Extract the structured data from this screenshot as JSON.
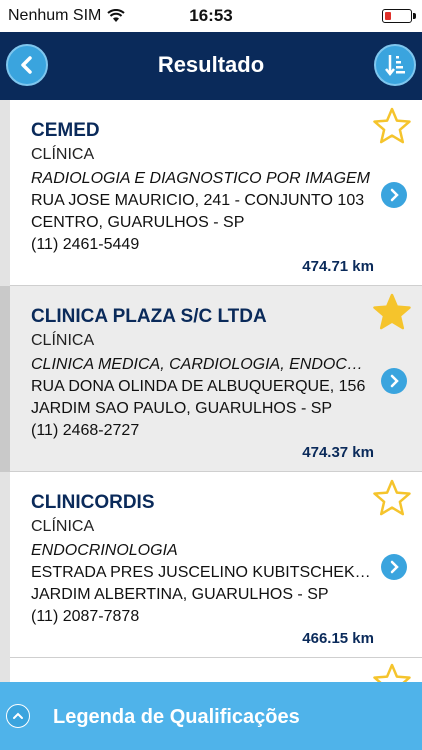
{
  "status_bar": {
    "carrier": "Nenhum SIM",
    "time": "16:53"
  },
  "nav": {
    "title": "Resultado"
  },
  "results": [
    {
      "name": "CEMED",
      "type": "CLÍNICA",
      "specialty": "RADIOLOGIA E DIAGNOSTICO POR IMAGEM",
      "address": "RUA JOSE MAURICIO, 241 - CONJUNTO 103",
      "city": "CENTRO, GUARULHOS - SP",
      "phone": "(11) 2461-5449",
      "distance": "474.71 km",
      "favorite": false
    },
    {
      "name": "CLINICA PLAZA S/C LTDA",
      "type": "CLÍNICA",
      "specialty": "CLINICA MEDICA, CARDIOLOGIA, ENDOCRINOLOGIA",
      "address": "RUA DONA OLINDA DE ALBUQUERQUE, 156",
      "city": "JARDIM SAO PAULO, GUARULHOS - SP",
      "phone": "(11) 2468-2727",
      "distance": "474.37 km",
      "favorite": true
    },
    {
      "name": "CLINICORDIS",
      "type": "CLÍNICA",
      "specialty": "ENDOCRINOLOGIA",
      "address": "ESTRADA PRES JUSCELINO KUBITSCHEK DE OLIVEIRA",
      "city": "JARDIM ALBERTINA, GUARULHOS - SP",
      "phone": "(11) 2087-7878",
      "distance": "466.15 km",
      "favorite": false
    }
  ],
  "bottom_bar": {
    "label": "Legenda de Qualificações"
  },
  "colors": {
    "navy": "#0a2a5a",
    "accent": "#3aa4de",
    "bottom": "#4fb3ea",
    "star": "#f5c42c"
  },
  "icons": {
    "back": "chevron-left-icon",
    "sort": "sort-list-icon",
    "star": "star-icon",
    "detail": "chevron-right-icon",
    "expand": "chevron-up-icon"
  }
}
